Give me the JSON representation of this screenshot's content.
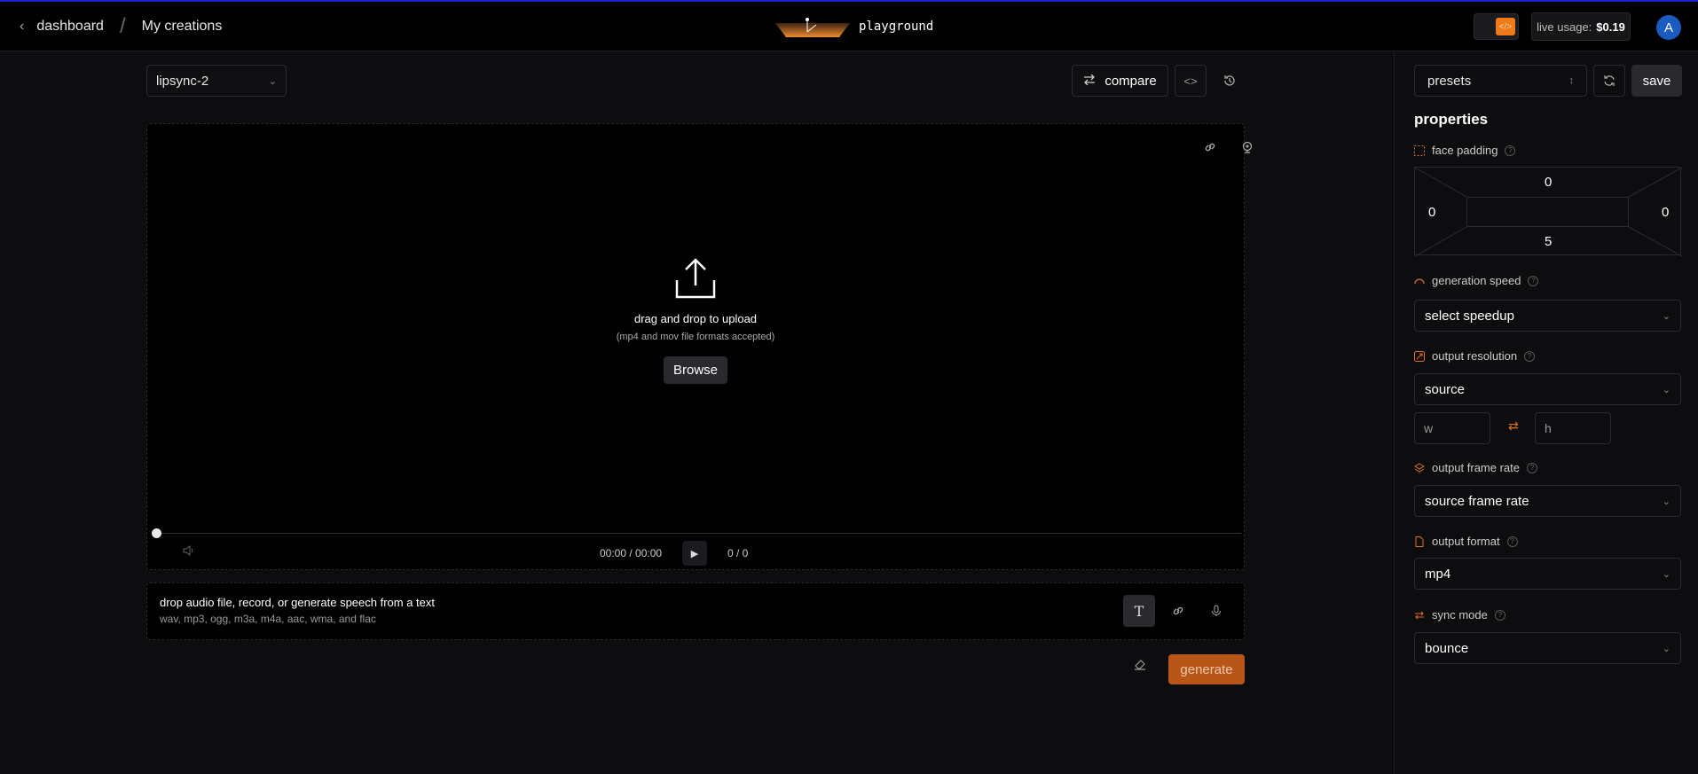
{
  "header": {
    "back_label": "dashboard",
    "crumb_current": "My creations",
    "brand": "playground",
    "usage_label": "live usage:",
    "usage_value": "$0.19",
    "avatar_initial": "A"
  },
  "toolbar": {
    "model": "lipsync-2",
    "compare_label": "compare"
  },
  "video": {
    "upload_title": "drag and drop to upload",
    "upload_hint": "(mp4 and mov file formats accepted)",
    "browse_label": "Browse",
    "time": "00:00 / 00:00",
    "count": "0 / 0"
  },
  "audio": {
    "title": "drop audio file, record, or generate speech from a text",
    "formats": "wav, mp3, ogg, m3a, m4a, aac, wma, and flac"
  },
  "generate_label": "generate",
  "sidebar": {
    "presets_label": "presets",
    "save_label": "save",
    "properties_title": "properties",
    "face_padding": {
      "label": "face padding",
      "top": "0",
      "left": "0",
      "right": "0",
      "bottom": "5"
    },
    "generation_speed": {
      "label": "generation speed",
      "value": "select speedup"
    },
    "output_resolution": {
      "label": "output resolution",
      "value": "source",
      "w_placeholder": "w",
      "h_placeholder": "h"
    },
    "output_frame_rate": {
      "label": "output frame rate",
      "value": "source frame rate"
    },
    "output_format": {
      "label": "output format",
      "value": "mp4"
    },
    "sync_mode": {
      "label": "sync mode",
      "value": "bounce"
    }
  },
  "colors": {
    "accent": "#f07a18",
    "generate_bg": "#b8561a",
    "avatar": "#1a5bbf",
    "topline": "#1b22c8"
  }
}
